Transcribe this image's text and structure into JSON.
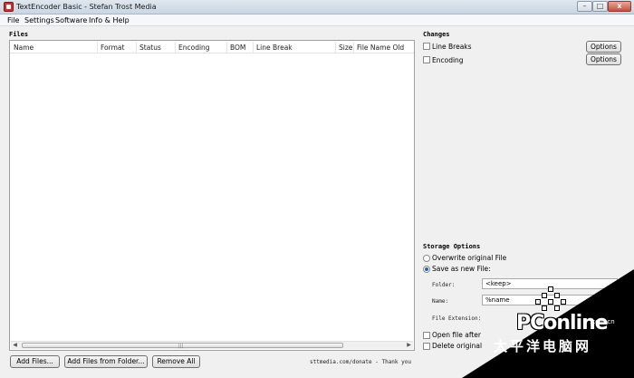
{
  "window": {
    "title": "TextEncoder Basic - Stefan Trost Media",
    "minimize": "–",
    "maximize": "□",
    "close": "x"
  },
  "menu": [
    "File",
    "Settings",
    "Software",
    "Info & Help"
  ],
  "files": {
    "title": "Files",
    "columns": [
      "Name",
      "Format",
      "Status",
      "Encoding",
      "BOM",
      "Line Break",
      "Size",
      "File Name Old"
    ],
    "rows": []
  },
  "buttons": {
    "add_files": "Add Files...",
    "add_from_folder": "Add Files from Folder...",
    "remove_all": "Remove All"
  },
  "footer": "sttmedia.com/donate - Thank you",
  "changes": {
    "title": "Changes",
    "line_breaks": {
      "label": "Line Breaks",
      "checked": false,
      "options": "Options"
    },
    "encoding": {
      "label": "Encoding",
      "checked": false,
      "options": "Options"
    }
  },
  "storage": {
    "title": "Storage Options",
    "overwrite": "Overwrite original File",
    "save_as_new": "Save as new File:",
    "selected": "save_as_new",
    "folder_label": "Folder:",
    "folder_value": "<keep>",
    "name_label": "Name:",
    "name_value": "%name",
    "extension_label": "File Extension:",
    "open_after": "Open file after",
    "delete_original": "Delete original"
  },
  "watermark": {
    "brand": "PConline",
    "suffix": ".com.cn",
    "cn": "太平洋电脑网"
  }
}
